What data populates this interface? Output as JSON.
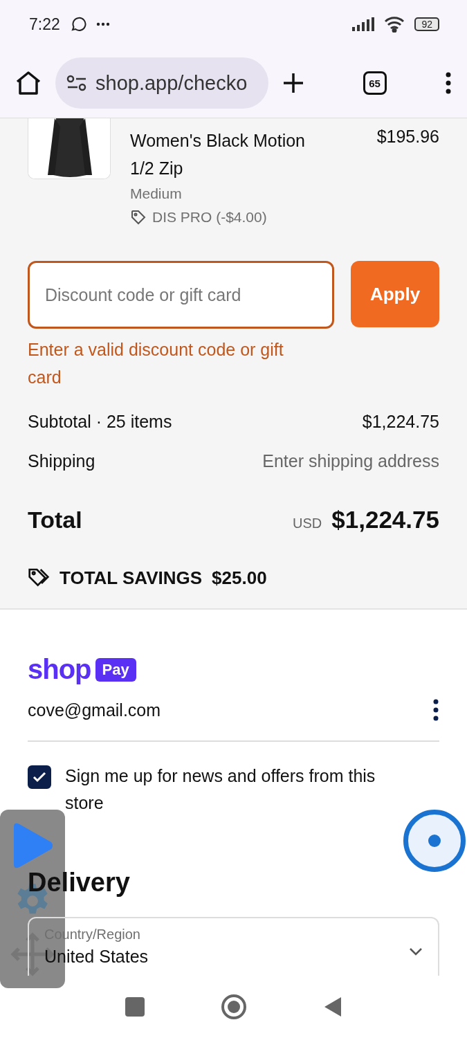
{
  "status_bar": {
    "time": "7:22",
    "battery": "92"
  },
  "browser": {
    "url": "shop.app/checko",
    "tab_count": "65"
  },
  "product": {
    "title": "Women's Black Motion 1/2 Zip",
    "price": "$195.96",
    "variant": "Medium",
    "discount": "DIS PRO (-$4.00)"
  },
  "discount": {
    "placeholder": "Discount code or gift card",
    "button": "Apply",
    "error": "Enter a valid discount code or gift card"
  },
  "summary": {
    "rows": [
      {
        "kind": "amount",
        "label": "Subtotal · 25 items",
        "value": "$1,224.75"
      },
      {
        "kind": "hint",
        "label": "Shipping",
        "value": "Enter shipping address"
      }
    ],
    "total": {
      "label": "Total",
      "currency": "USD",
      "amount": "$1,224.75"
    },
    "savings": {
      "label": "TOTAL SAVINGS",
      "amount": "$25.00"
    }
  },
  "shop_pay": {
    "logo": "shop",
    "badge": "Pay",
    "email": "cove@gmail.com"
  },
  "newsletter": {
    "label": "Sign me up for news and offers from this store",
    "checked": true
  },
  "delivery": {
    "heading": "Delivery",
    "country_label": "Country/Region",
    "country_value": "United States"
  }
}
